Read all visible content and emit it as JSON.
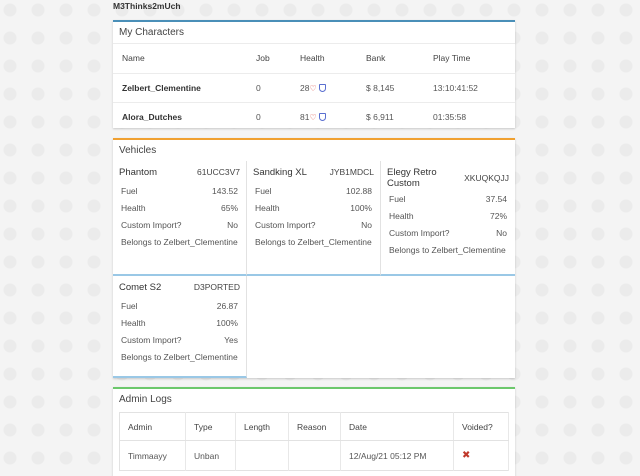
{
  "user": {
    "name": "M3Thinks2mUch"
  },
  "characters": {
    "title": "My Characters",
    "headers": {
      "name": "Name",
      "job": "Job",
      "health": "Health",
      "bank": "Bank",
      "playtime": "Play Time"
    },
    "rows": [
      {
        "name": "Zelbert_Clementine",
        "job": "0",
        "health": "28",
        "bank": "$ 8,145",
        "playtime": "13:10:41:52"
      },
      {
        "name": "Alora_Dutches",
        "job": "0",
        "health": "81",
        "bank": "$ 6,911",
        "playtime": "01:35:58"
      }
    ]
  },
  "vehicles": {
    "title": "Vehicles",
    "labels": {
      "fuel": "Fuel",
      "health": "Health",
      "custom": "Custom Import?"
    },
    "items": [
      {
        "name": "Phantom",
        "plate": "61UCC3V7",
        "fuel": "143.52",
        "health": "65%",
        "custom": "No",
        "owner": "Belongs to Zelbert_Clementine"
      },
      {
        "name": "Sandking XL",
        "plate": "JYB1MDCL",
        "fuel": "102.88",
        "health": "100%",
        "custom": "No",
        "owner": "Belongs to Zelbert_Clementine"
      },
      {
        "name": "Elegy Retro Custom",
        "plate": "XKUQKQJJ",
        "fuel": "37.54",
        "health": "72%",
        "custom": "No",
        "owner": "Belongs to Zelbert_Clementine"
      },
      {
        "name": "Comet S2",
        "plate": "D3PORTED",
        "fuel": "26.87",
        "health": "100%",
        "custom": "Yes",
        "owner": "Belongs to Zelbert_Clementine"
      }
    ]
  },
  "admin_logs": {
    "title": "Admin Logs",
    "headers": {
      "admin": "Admin",
      "type": "Type",
      "length": "Length",
      "reason": "Reason",
      "date": "Date",
      "voided": "Voided?"
    },
    "rows": [
      {
        "admin": "Timmaayy",
        "type": "Unban",
        "length": "",
        "reason": "",
        "date": "12/Aug/21 05:12 PM",
        "voided_icon": "x-mark-icon"
      }
    ]
  },
  "colors": {
    "characters_accent": "#4a8fb8",
    "vehicles_accent": "#f0a030",
    "admin_accent": "#6cc86c",
    "void_x": "#c0392b"
  }
}
